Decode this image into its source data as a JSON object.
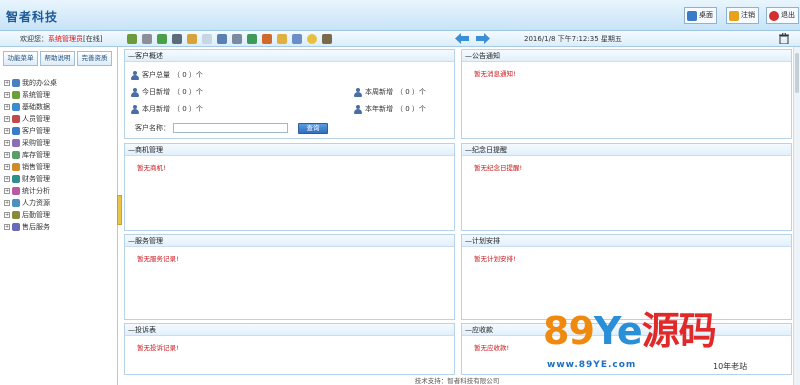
{
  "header": {
    "logo": "智者科技",
    "buttons": [
      {
        "label": "桌面",
        "icon": "desktop-icon",
        "color": "#3a7bc8"
      },
      {
        "label": "注销",
        "icon": "logout-icon",
        "color": "#e6a21b"
      },
      {
        "label": "退出",
        "icon": "exit-icon",
        "color": "#d23030"
      }
    ]
  },
  "toolbar": {
    "welcome_prefix": "欢迎您：",
    "role": "系统管理员",
    "welcome_suffix": "[在线]",
    "datetime": "2016/1/8 下午7:12:35 星期五",
    "icons": [
      "message-icon",
      "settings-icon",
      "refresh-icon",
      "print-icon",
      "tag-icon",
      "mail-icon",
      "calendar-icon",
      "contacts-icon",
      "chart-icon",
      "home-icon",
      "folder-icon",
      "notes-icon",
      "help-icon",
      "archive-icon"
    ]
  },
  "sidebar": {
    "tabs": [
      "功能菜单",
      "帮助说明",
      "完善资质"
    ],
    "items": [
      {
        "label": "我的办公桌",
        "color": "#4a7fc1"
      },
      {
        "label": "系统管理",
        "color": "#6a9f3a"
      },
      {
        "label": "基础数据",
        "color": "#3b8dd0"
      },
      {
        "label": "人员管理",
        "color": "#c04a4a"
      },
      {
        "label": "客户管理",
        "color": "#3a7bc8"
      },
      {
        "label": "采购管理",
        "color": "#8a6fb8"
      },
      {
        "label": "库存管理",
        "color": "#5a9c6a"
      },
      {
        "label": "销售管理",
        "color": "#d08a2a"
      },
      {
        "label": "财务管理",
        "color": "#2f8f8f"
      },
      {
        "label": "统计分析",
        "color": "#b85aa0"
      },
      {
        "label": "人力资源",
        "color": "#4a90c0"
      },
      {
        "label": "后勤管理",
        "color": "#8a8a3a"
      },
      {
        "label": "售后服务",
        "color": "#6a6ab8"
      }
    ]
  },
  "panels": {
    "customer": {
      "title": "客户概述",
      "stats": [
        {
          "label": "客户总量",
          "value": "（ 0 ）个"
        },
        {
          "label": "今日新增",
          "value": "（ 0 ）个"
        },
        {
          "label": "本周新增",
          "value": "（ 0 ）个"
        },
        {
          "label": "本月新增",
          "value": "（ 0 ）个"
        },
        {
          "label": "本年新增",
          "value": "（ 0 ）个"
        }
      ],
      "search_label": "客户名称：",
      "search_value": "",
      "query_button": "查询"
    },
    "notice": {
      "title": "公告通知",
      "empty": "暂无消息通知!"
    },
    "business": {
      "title": "商机管理",
      "empty": "暂无商机!"
    },
    "memorial": {
      "title": "纪念日提醒",
      "empty": "暂无纪念日提醒!"
    },
    "service": {
      "title": "服务管理",
      "empty": "暂无服务记录!"
    },
    "plan": {
      "title": "计划安排",
      "empty": "暂无计划安排!"
    },
    "complaint": {
      "title": "投诉表",
      "empty": "暂无投诉记录!"
    },
    "payment": {
      "title": "应收款",
      "empty": "暂无应收款!"
    }
  },
  "footer": {
    "text": "技术支持：智者科技有限公司"
  },
  "watermark": {
    "brand_num": "89",
    "brand_ye": "Ye",
    "brand_cn": "源码",
    "url": "www.89YE.com",
    "tag": "10年老站"
  }
}
